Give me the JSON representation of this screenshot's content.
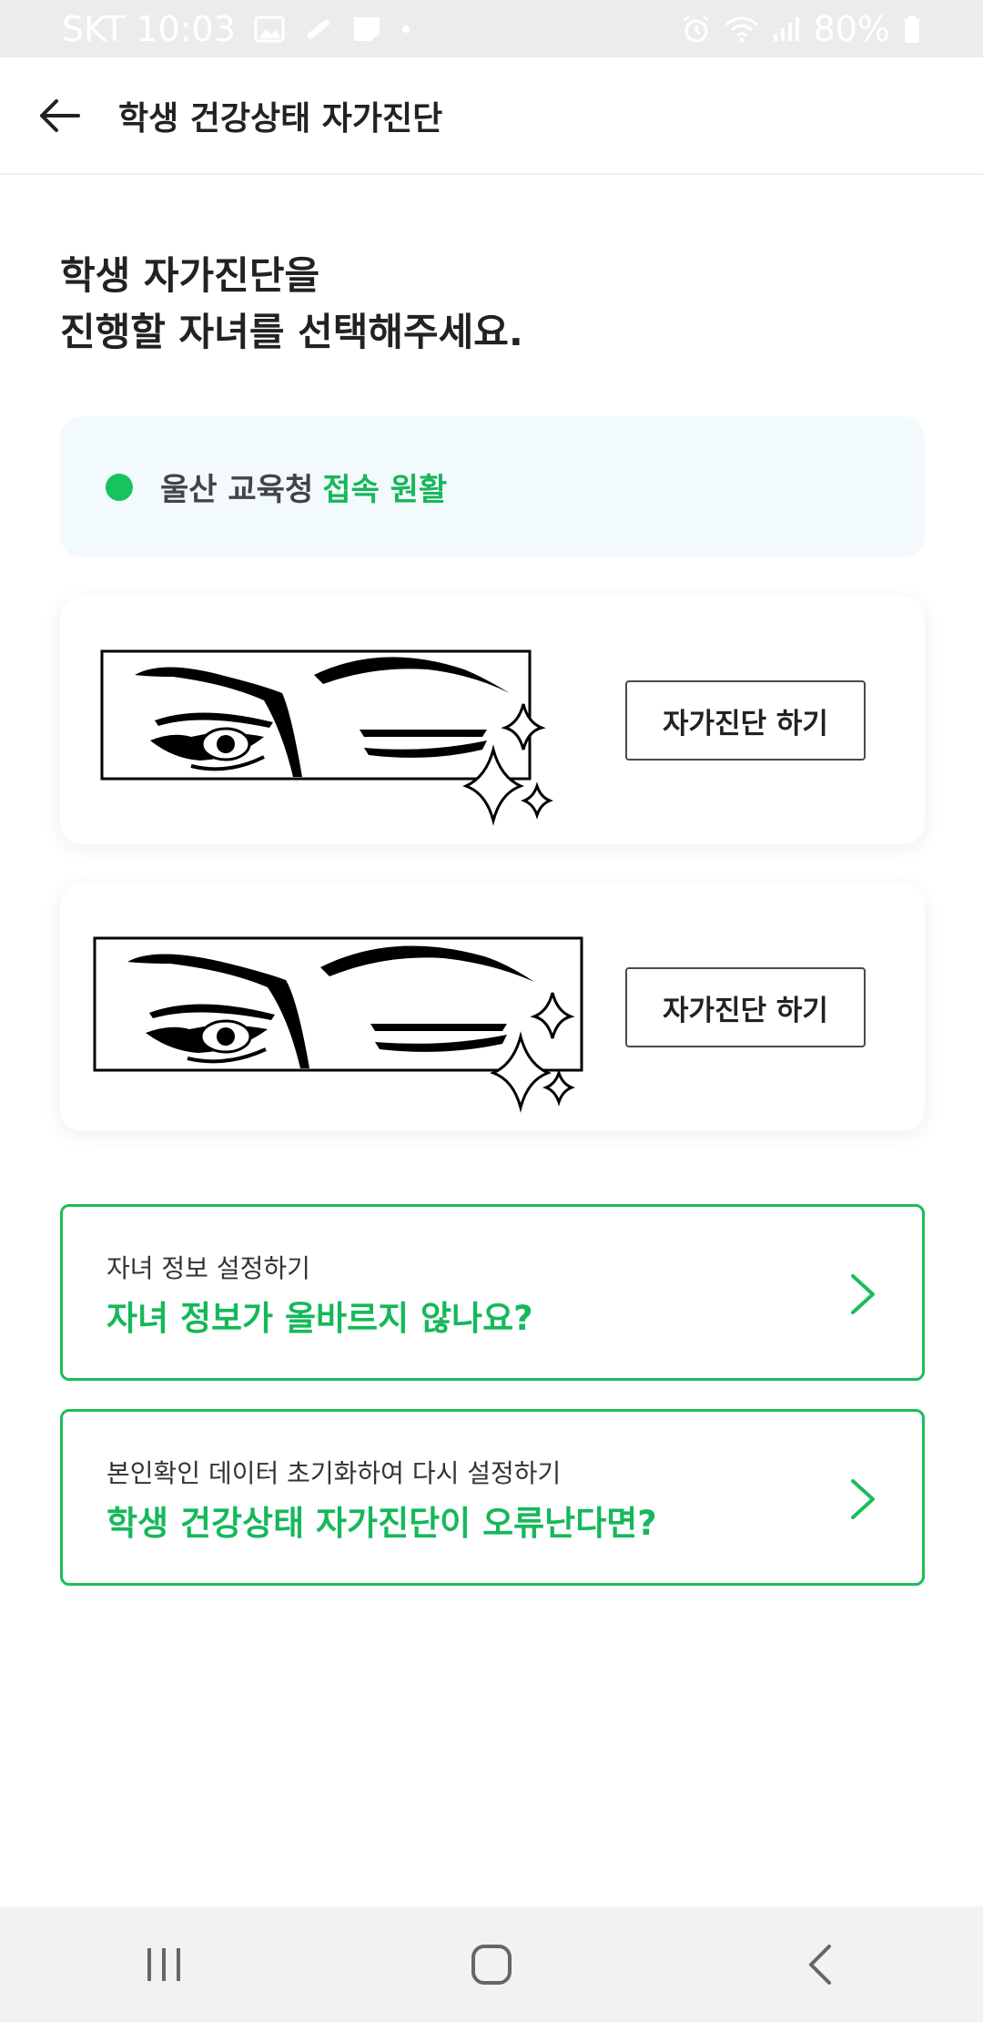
{
  "status_bar": {
    "carrier_time": "SKT 10:03",
    "battery": "80%",
    "icons_left": [
      "image-icon",
      "link-icon",
      "note-icon",
      "dot-icon"
    ],
    "icons_right": [
      "alarm-icon",
      "wifi-icon",
      "signal-icon",
      "battery-icon"
    ]
  },
  "app_bar": {
    "back_icon": "arrow-left-icon",
    "title": "학생 건강상태 자가진단"
  },
  "heading": {
    "line1": "학생 자가진단을",
    "line2": "진행할 자녀를 선택해주세요."
  },
  "server_status": {
    "region": "울산 교육청",
    "status": "접속 원활",
    "status_color": "#17c35d"
  },
  "students": [
    {
      "illustration": "winking-eyes-sparkle",
      "button_label": "자가진단 하기"
    },
    {
      "illustration": "winking-eyes-sparkle",
      "button_label": "자가진단 하기"
    }
  ],
  "links": [
    {
      "subtitle": "자녀 정보 설정하기",
      "title": "자녀 정보가 올바르지 않나요?",
      "icon": "chevron-right-icon"
    },
    {
      "subtitle": "본인확인 데이터 초기화하여 다시 설정하기",
      "title": "학생 건강상태 자가진단이 오류난다면?",
      "icon": "chevron-right-icon"
    }
  ],
  "nav_bar": {
    "items": [
      "recent-apps-icon",
      "home-icon",
      "back-icon"
    ]
  },
  "colors": {
    "accent_green": "#17b65a",
    "server_box_bg": "#f3fafd"
  }
}
